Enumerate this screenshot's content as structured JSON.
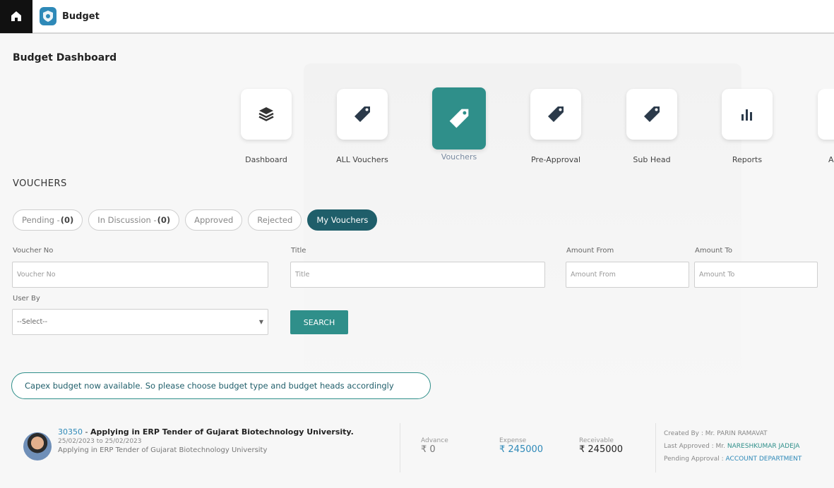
{
  "app": {
    "title": "Budget"
  },
  "page_title": "Budget Dashboard",
  "nav": [
    {
      "label": "Dashboard",
      "icon": "layers-icon"
    },
    {
      "label": "ALL Vouchers",
      "icon": "tag-icon"
    },
    {
      "label": "Vouchers",
      "icon": "tag-icon",
      "active": true
    },
    {
      "label": "Pre-Approval",
      "icon": "tag-icon"
    },
    {
      "label": "Sub Head",
      "icon": "tag-icon"
    },
    {
      "label": "Reports",
      "icon": "bar-chart-icon"
    },
    {
      "label": "Ac",
      "icon": "unknown-icon"
    }
  ],
  "section_title": "VOUCHERS",
  "tabs": {
    "pending_label": "Pending -",
    "pending_count": "(0)",
    "discussion_label": "In Discussion -",
    "discussion_count": "(0)",
    "approved": "Approved",
    "rejected": "Rejected",
    "my_vouchers": "My Vouchers"
  },
  "filters": {
    "voucher_no_label": "Voucher No",
    "voucher_no_placeholder": "Voucher No",
    "title_label": "Title",
    "title_placeholder": "Title",
    "amount_from_label": "Amount From",
    "amount_from_placeholder": "Amount From",
    "amount_to_label": "Amount To",
    "amount_to_placeholder": "Amount To",
    "user_by_label": "User By",
    "user_by_selected": "--Select--",
    "search_label": "SEARCH"
  },
  "notice": "Capex budget now available. So please choose budget type and budget heads accordingly",
  "voucher": {
    "number": "30350",
    "separator": " - ",
    "title": "Applying in ERP Tender of Gujarat Biotechnology University.",
    "dates": "25/02/2023 to 25/02/2023",
    "description": "Applying in ERP Tender of Gujarat Biotechnology University",
    "advance_label": "Advance",
    "advance_value": "₹ 0",
    "expense_label": "Expense",
    "expense_value": "₹ 245000",
    "receivable_label": "Receivable",
    "receivable_value": "₹ 245000",
    "created_by_label": "Created By : ",
    "created_by": "Mr. PARIN RAMAVAT",
    "last_approved_label": "Last Approved : ",
    "last_approved_prefix": "Mr. ",
    "last_approved": "NARESHKUMAR JADEJA",
    "pending_label": "Pending Approval : ",
    "pending": "ACCOUNT DEPARTMENT"
  }
}
